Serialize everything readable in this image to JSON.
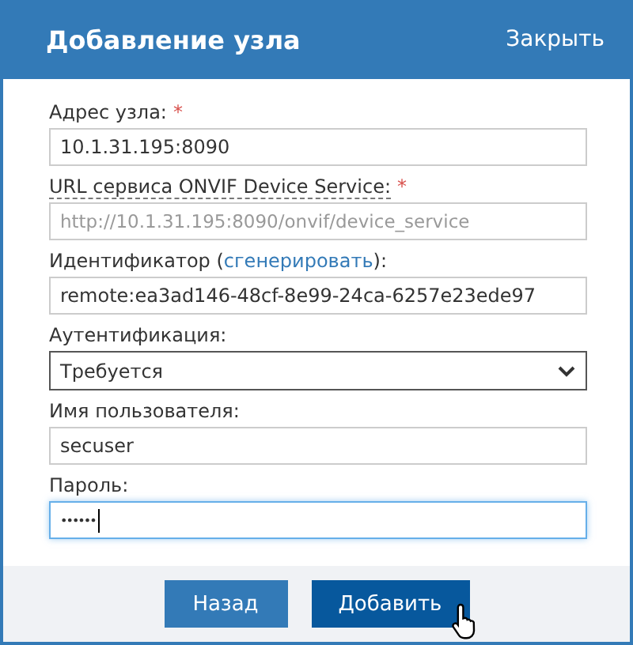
{
  "dialog": {
    "title": "Добавление узла",
    "close": "Закрыть"
  },
  "fields": [
    {
      "kind": "text",
      "label": "Адрес узла:",
      "required_mark": "*",
      "value": "10.1.31.195:8090"
    },
    {
      "kind": "text",
      "label": "URL сервиса ONVIF Device Service:",
      "required_mark": "*",
      "hint_underline": true,
      "placeholder": "http://10.1.31.195:8090/onvif/device_service"
    },
    {
      "kind": "text",
      "label": "Идентификатор (",
      "link": "сгенерировать",
      "label_after": "):",
      "value": "remote:ea3ad146-48cf-8e99-24ca-6257e23ede97"
    },
    {
      "kind": "select",
      "label": "Аутентификация:",
      "value": "Требуется"
    },
    {
      "kind": "text",
      "label": "Имя пользователя:",
      "value": "secuser"
    },
    {
      "kind": "password",
      "label": "Пароль:",
      "value": "••••••",
      "focused": true
    }
  ],
  "buttons": [
    {
      "label": "Назад",
      "primary": false
    },
    {
      "label": "Добавить",
      "primary": true,
      "hovered": true
    }
  ]
}
